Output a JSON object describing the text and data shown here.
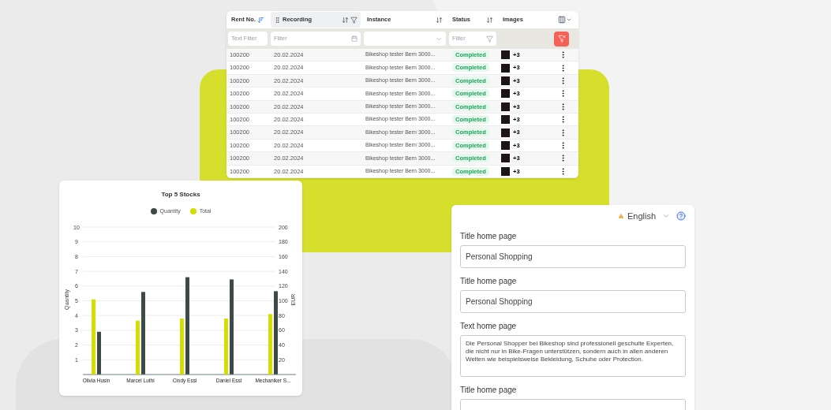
{
  "table": {
    "columns": [
      {
        "label": "Rent No.",
        "sortable": true,
        "sorted": true,
        "highlighted": false,
        "filter": {
          "kind": "text",
          "placeholder": "Text Filter"
        }
      },
      {
        "label": "Recording",
        "sortable": true,
        "sorted": false,
        "highlighted": true,
        "filter": {
          "kind": "date",
          "placeholder": "Filter"
        }
      },
      {
        "label": "Instance",
        "sortable": true,
        "sorted": false,
        "highlighted": false,
        "filter": {
          "kind": "select"
        }
      },
      {
        "label": "Status",
        "sortable": true,
        "sorted": false,
        "highlighted": false,
        "filter": {
          "kind": "funnel",
          "placeholder": "Filter"
        }
      },
      {
        "label": "Images",
        "sortable": false,
        "sorted": false,
        "highlighted": false,
        "filter": {
          "kind": "none"
        }
      }
    ],
    "rows": [
      {
        "rent_no": "100200",
        "recording": "20.02.2024",
        "instance": "Bikeshop tester Bern 3000...",
        "status": "Completed",
        "extra_images": "+3"
      },
      {
        "rent_no": "100200",
        "recording": "20.02.2024",
        "instance": "Bikeshop tester Bern 3000...",
        "status": "Completed",
        "extra_images": "+3"
      },
      {
        "rent_no": "100200",
        "recording": "20.02.2024",
        "instance": "Bikeshop tester Bern 3000...",
        "status": "Completed",
        "extra_images": "+3"
      },
      {
        "rent_no": "100200",
        "recording": "20.02.2024",
        "instance": "Bikeshop tester Bern 3000...",
        "status": "Completed",
        "extra_images": "+3"
      },
      {
        "rent_no": "100200",
        "recording": "20.02.2024",
        "instance": "Bikeshop tester Bern 3000...",
        "status": "Completed",
        "extra_images": "+3"
      },
      {
        "rent_no": "100200",
        "recording": "20.02.2024",
        "instance": "Bikeshop tester Bern 3000...",
        "status": "Completed",
        "extra_images": "+3"
      },
      {
        "rent_no": "100200",
        "recording": "20.02.2024",
        "instance": "Bikeshop tester Bern 3000...",
        "status": "Completed",
        "extra_images": "+3"
      },
      {
        "rent_no": "100200",
        "recording": "20.02.2024",
        "instance": "Bikeshop tester Bern 3000...",
        "status": "Completed",
        "extra_images": "+3"
      },
      {
        "rent_no": "100200",
        "recording": "20.02.2024",
        "instance": "Bikeshop tester Bern 3000...",
        "status": "Completed",
        "extra_images": "+3"
      },
      {
        "rent_no": "100200",
        "recording": "20.02.2024",
        "instance": "Bikeshop tester Bern 3000...",
        "status": "Completed",
        "extra_images": "+3"
      }
    ]
  },
  "stock_chart": {
    "chart_data": {
      "type": "bar",
      "title": "Top 5 Stocks",
      "ylabel": "Quantity",
      "grid": true,
      "categories": [
        "Olivia Husin",
        "Marcel Luthi",
        "Cindy Essl",
        "Daniel Essl",
        "Mechaniker S..."
      ],
      "series": [
        {
          "name": "Quantity",
          "color": "#3d4a47",
          "values": [
            2.9,
            5.6,
            6.6,
            6.45,
            5.65
          ]
        }
      ],
      "ylim": [
        0,
        10
      ],
      "yticks": [
        1,
        2,
        3,
        4,
        5,
        6,
        7,
        8,
        9,
        10
      ]
    },
    "eur_axis": {
      "chart_data": {
        "type": "bar",
        "ylabel": "EUR",
        "series": [
          {
            "name": "Total",
            "color": "#d4df00",
            "values": [
              102,
              73,
              76,
              76,
              82
            ]
          }
        ],
        "ylim": [
          0,
          200
        ],
        "yticks": [
          20,
          40,
          60,
          80,
          100,
          120,
          140,
          160,
          180,
          200
        ]
      }
    }
  },
  "content_form": {
    "language": "English",
    "language_warning": true,
    "fields": [
      {
        "kind": "input",
        "label": "Title home page",
        "value": "Personal Shopping"
      },
      {
        "kind": "input",
        "label": "Title home page",
        "value": "Personal Shopping"
      },
      {
        "kind": "textarea",
        "label": "Text home page",
        "value": "Die Personal Shopper bei Bikeshop sind professionell geschulte Experten, die nicht nur in Bike-Fragen unterstützen, sondern auch in allen anderen Welten wie beispielsweise Bekleidung, Schuhe oder Protection."
      },
      {
        "kind": "input",
        "label": "Title home page"
      }
    ]
  }
}
